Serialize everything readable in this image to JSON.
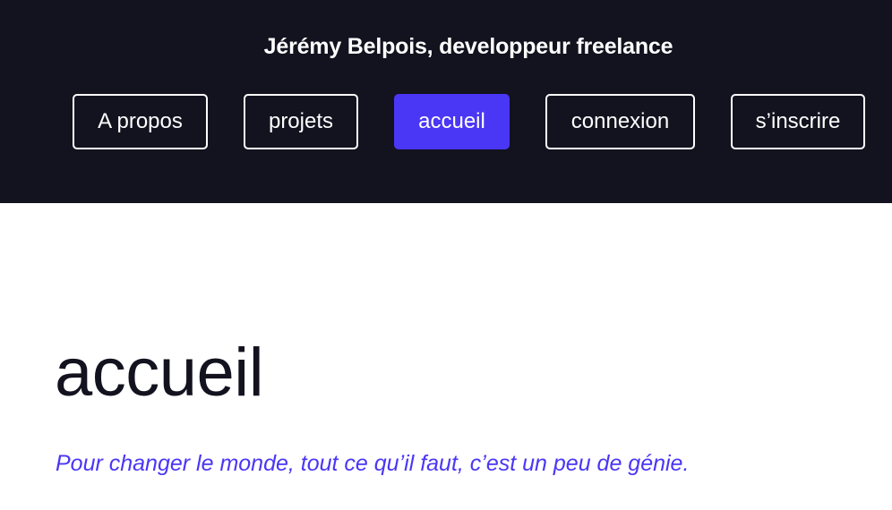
{
  "header": {
    "title": "Jérémy Belpois, developpeur freelance"
  },
  "nav": {
    "items": [
      {
        "label": "A propos"
      },
      {
        "label": "projets"
      },
      {
        "label": "accueil"
      },
      {
        "label": "connexion"
      },
      {
        "label": "s’inscrire"
      }
    ]
  },
  "main": {
    "heading": "accueil",
    "tagline": "Pour changer le monde, tout ce qu’il faut, c’est un peu de génie."
  },
  "colors": {
    "header_bg": "#13121f",
    "accent": "#4a36f5",
    "text_dark": "#13121f",
    "text_light": "#ffffff"
  }
}
